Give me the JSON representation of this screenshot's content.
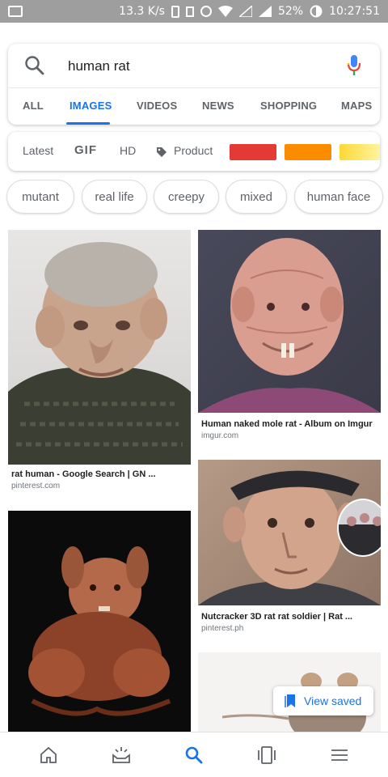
{
  "status_bar": {
    "speed": "13.3 K/s",
    "battery": "52%",
    "time": "10:27:51"
  },
  "search": {
    "query": "human rat"
  },
  "tabs": [
    {
      "label": "ALL"
    },
    {
      "label": "IMAGES",
      "active": true
    },
    {
      "label": "VIDEOS"
    },
    {
      "label": "NEWS"
    },
    {
      "label": "SHOPPING"
    },
    {
      "label": "MAPS"
    }
  ],
  "filters": {
    "latest": "Latest",
    "gif": "GIF",
    "hd": "HD",
    "product": "Product",
    "colors": [
      "#e53935",
      "#fb8c00",
      "#fdd835"
    ]
  },
  "chips": [
    "mutant",
    "real life",
    "creepy",
    "mixed",
    "human face"
  ],
  "results": [
    {
      "title": "rat human - Google Search | GN ...",
      "source": "pinterest.com"
    },
    {
      "title": "Human naked mole rat - Album on Imgur",
      "source": "imgur.com"
    },
    {
      "title": "Nutcracker 3D rat rat soldier | Rat ...",
      "source": "pinterest.ph"
    }
  ],
  "view_saved": {
    "label": "View saved"
  },
  "accent_color": "#1a73e8"
}
